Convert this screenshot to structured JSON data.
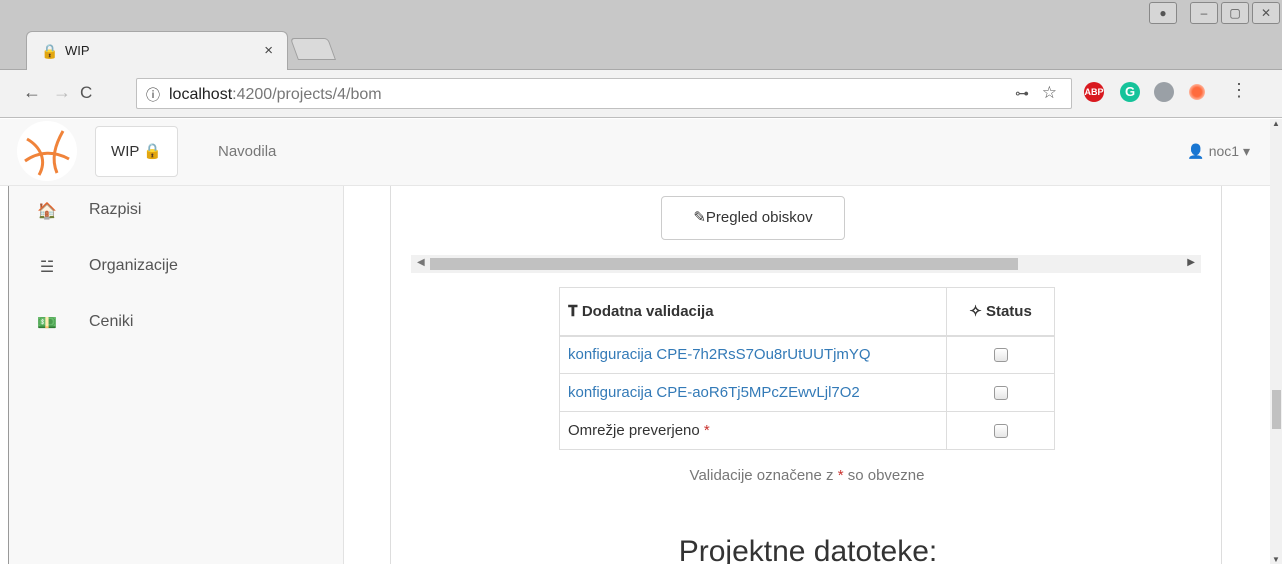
{
  "browser": {
    "tab": {
      "title": "WIP",
      "close": "×",
      "favicon": "lock-icon"
    },
    "window_buttons": [
      "●",
      "–",
      "▢",
      "✕"
    ],
    "url": {
      "host": "localhost",
      "path": ":4200/projects/4/bom"
    },
    "nav": {
      "back": "←",
      "forward": "→",
      "reload": "C"
    },
    "extensions": {
      "abp": "ABP",
      "grammarly": "G"
    }
  },
  "navbar": {
    "brand": "WIP",
    "link": "Navodila",
    "user": "noc1"
  },
  "sidebar": {
    "items": [
      {
        "label": "Razpisi",
        "icon": "home-icon"
      },
      {
        "label": "Organizacije",
        "icon": "sitemap-icon"
      },
      {
        "label": "Ceniki",
        "icon": "money-icon"
      }
    ]
  },
  "main": {
    "visits_button": "Pregled obiskov",
    "table": {
      "headers": [
        "Dodatna validacija",
        "Status"
      ],
      "rows": [
        {
          "label": "konfiguracija CPE-7h2RsS7Ou8rUtUUTjmYQ",
          "link": true,
          "checked": false
        },
        {
          "label": "konfiguracija CPE-aoR6Tj5MPcZEwvLjl7O2",
          "link": true,
          "checked": false
        },
        {
          "label": "Omrežje preverjeno",
          "required": "*",
          "link": false,
          "checked": false
        }
      ]
    },
    "note": {
      "before": "Validacije označene z ",
      "star": "*",
      "after": " so obvezne"
    },
    "section_title": "Projektne datoteke:"
  },
  "colors": {
    "link": "#337ab7",
    "required": "#c9302c"
  }
}
